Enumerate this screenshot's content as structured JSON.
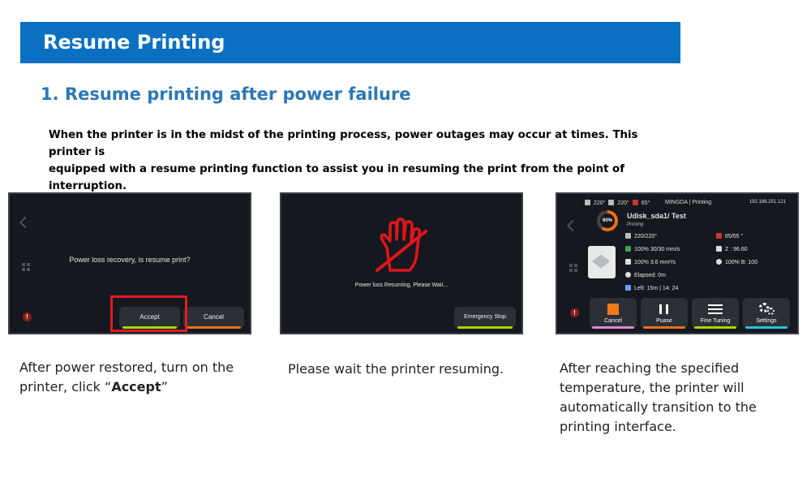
{
  "header": {
    "title": "Resume Printing"
  },
  "section": {
    "heading": "1. Resume printing after power failure"
  },
  "intro": {
    "line1": "When the printer is in the midst of the printing process, power outages may occur at times. This printer is",
    "line2": "equipped with a resume printing function to assist you in resuming the print from the point of interruption."
  },
  "screen1": {
    "message": "Power loss recovery, is resume print?",
    "accept_label": "Accept",
    "cancel_label": "Cancel",
    "alert_glyph": "!"
  },
  "screen2": {
    "message": "Power loss Resuming, Please Wait...",
    "emergency_label": "Emergency Stop"
  },
  "screen3": {
    "status": {
      "nozzle1": "220°",
      "nozzle2": "220°",
      "bed": "65°",
      "brand": "MINGDA",
      "separator": "|",
      "state": "Printing",
      "ip": "192.168.251.121"
    },
    "progress": "60%",
    "file": "Udisk_sda1/ Test",
    "file_state": "Printing",
    "stats": {
      "temp": "220/220°",
      "speed": "100% 30/30 mm/s",
      "flow": "100%   3.6 mm³/s",
      "elapsed": "Elapsed: 0m",
      "left": "Left:  15m | 14: 24",
      "bed": "65/65 °",
      "z": "Z : 96.60",
      "fan": "100% B: 100"
    },
    "buttons": {
      "cancel": "Cancel",
      "pause": "Puase",
      "fine": "Fine Tuning",
      "settings": "Settings"
    },
    "alert_glyph": "!"
  },
  "captions": {
    "c1_line1": "After power restored, turn on the",
    "c1_line2_pre": "printer, click “",
    "c1_line2_bold": "Accept",
    "c1_line2_post": "”",
    "c2": "Please wait the printer resuming.",
    "c3_line1": "After reaching the specified",
    "c3_line2": "temperature, the printer will",
    "c3_line3": "automatically transition to the",
    "c3_line4": "printing interface."
  },
  "colors": {
    "title_bar": "#0b70c2",
    "heading": "#2d77b5",
    "highlight": "#e11b22",
    "accept_bar": "#a6d608",
    "cancel_bar": "#e8711c",
    "hand_icon": "#e0151c",
    "pause_bar": "#e8711c",
    "fine_bar": "#a6d608",
    "settings_bar": "#22c7d9",
    "cancel_tile_bar": "#d98ad8"
  }
}
